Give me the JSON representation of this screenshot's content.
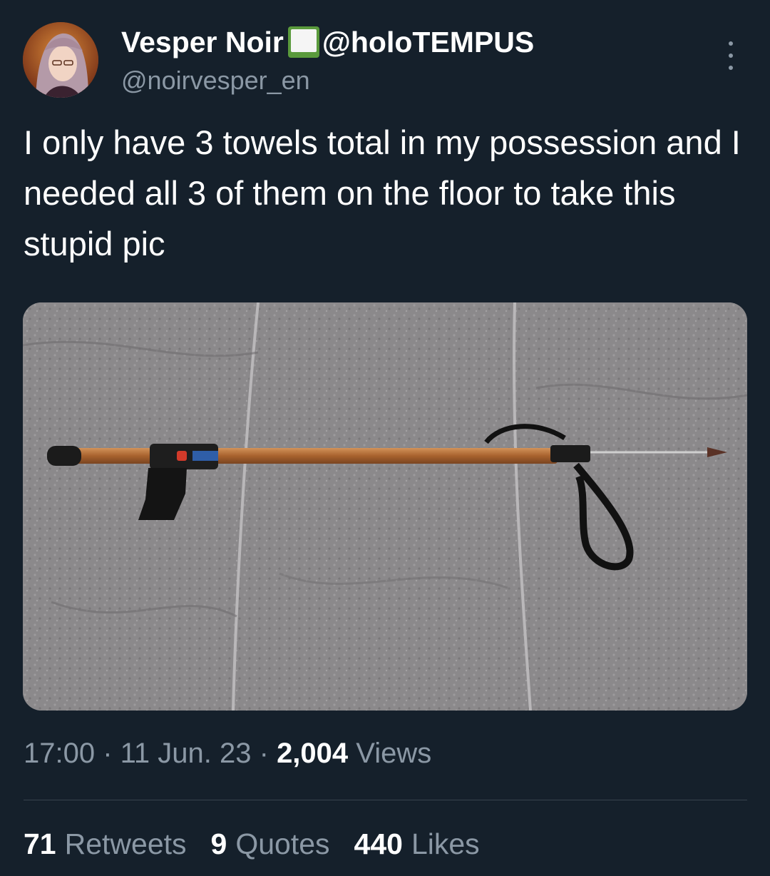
{
  "author": {
    "display_name": "Vesper Noir",
    "name_badge_icon": "green-book-icon",
    "affiliation": "@holoTEMPUS",
    "handle": "@noirvesper_en"
  },
  "tweet": {
    "text": "I only have 3 towels total in my possession and I needed all 3 of them on the floor to take this stupid pic",
    "media_icon": "speargun-photo"
  },
  "meta": {
    "time": "17:00",
    "sep1": " · ",
    "date": "11 Jun. 23",
    "sep2": " · ",
    "views_count": "2,004",
    "views_label": "Views"
  },
  "stats": {
    "retweets_count": "71",
    "retweets_label": "Retweets",
    "quotes_count": "9",
    "quotes_label": "Quotes",
    "likes_count": "440",
    "likes_label": "Likes"
  },
  "colors": {
    "background": "#15202b",
    "text_primary": "#ffffff",
    "text_secondary": "#8b98a5",
    "divider": "#38444d"
  }
}
